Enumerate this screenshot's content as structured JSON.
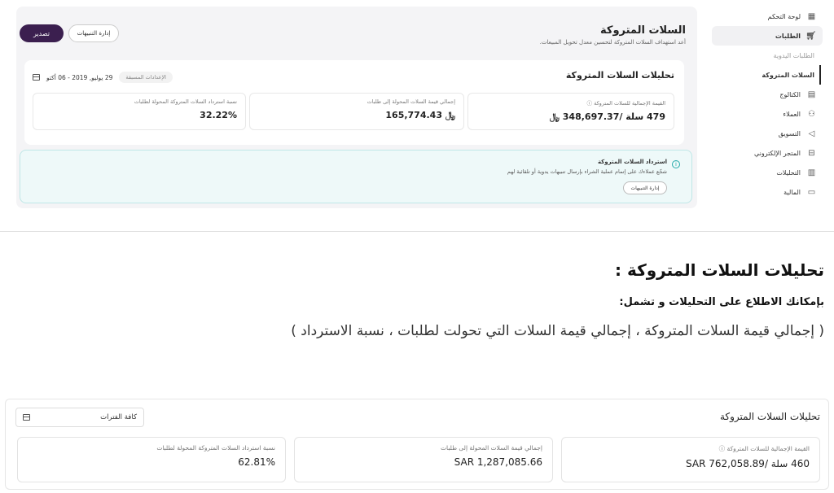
{
  "sidebar": {
    "items": [
      {
        "label": "لوحة التحكم",
        "icon": "dashboard-icon"
      },
      {
        "label": "الطلبات",
        "icon": "cart-icon"
      },
      {
        "label": "الطلبات اليدوية",
        "icon": ""
      },
      {
        "label": "السلات المتروكة",
        "icon": ""
      },
      {
        "label": "الكتالوج",
        "icon": "catalog-icon"
      },
      {
        "label": "العملاء",
        "icon": "users-icon"
      },
      {
        "label": "التسويق",
        "icon": "megaphone-icon"
      },
      {
        "label": "المتجر الإلكتروني",
        "icon": "store-icon"
      },
      {
        "label": "التحليلات",
        "icon": "bar-chart-icon"
      },
      {
        "label": "المالية",
        "icon": "wallet-icon"
      }
    ]
  },
  "header": {
    "title": "السلات المتروكة",
    "subtitle": "أعد استهداف السلات المتروكة لتحسين معدل تحويل المبيعات.",
    "export_label": "تصدير",
    "alerts_label": "إدارة التنبيهات"
  },
  "analytics_card": {
    "title": "تحليلات السلات المتروكة",
    "chip": "الإعدادات المسبقة",
    "date_range": "29 يوليو, 2019 - 06 أكتو",
    "stats": [
      {
        "label": "القيمة الإجمالية للسلات المتروكة ⓘ",
        "value": "479 سلة /348,697.37 ﷼"
      },
      {
        "label": "إجمالي قيمة السلات المحولة إلى طلبات",
        "value": "﷼ 165,774.43"
      },
      {
        "label": "نسبة استرداد السلات المتروكة المحولة لطلبات",
        "value": "32.22%"
      }
    ]
  },
  "recovery_card": {
    "title": "استرداد السلات المتروكة",
    "desc": "شجّع عملاءك على إتمام عملية الشراء بإرسال تنبيهات يدوية أو تلقائية لهم",
    "button": "إدارة التنبيهات"
  },
  "article": {
    "h1": "تحليلات السلات المتروكة :",
    "h2": "بإمكانك الاطلاع على التحليلات و تشمل:",
    "p": "( إجمالي قيمة السلات المتروكة ، إجمالي قيمة السلات التي تحولت لطلبات ، نسبة الاسترداد )"
  },
  "bottom": {
    "title": "تحليلات السلات المتروكة",
    "filter": "كافة الفترات",
    "stats": [
      {
        "label": "القيمة الإجمالية للسلات المتروكة ⓘ",
        "value": "460 سلة /SAR 762,058.89"
      },
      {
        "label": "إجمالي قيمة السلات المحولة إلى طلبات",
        "value": "SAR 1,287,085.66"
      },
      {
        "label": "نسبة استرداد السلات المتروكة المحولة لطلبات",
        "value": "62.81%"
      }
    ]
  }
}
